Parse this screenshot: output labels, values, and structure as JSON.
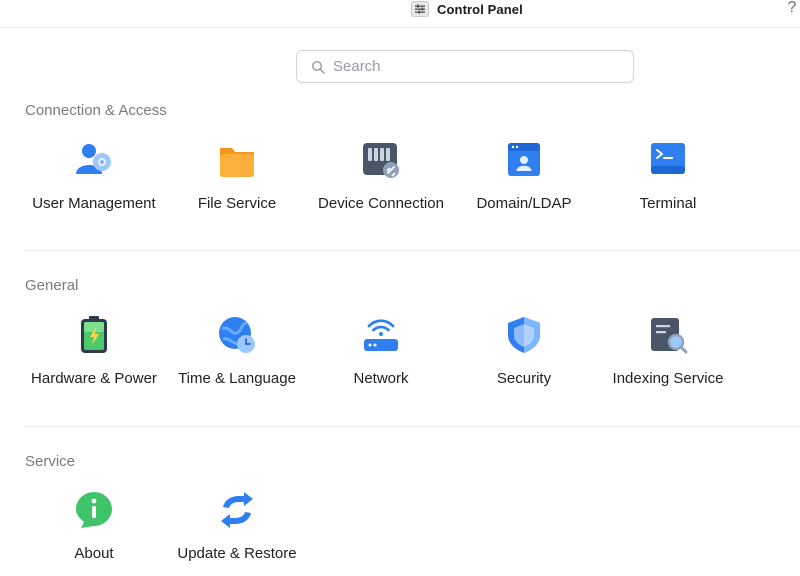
{
  "window": {
    "title": "Control Panel",
    "help_label": "?"
  },
  "search": {
    "placeholder": "Search"
  },
  "sections": [
    {
      "title": "Connection & Access",
      "items": [
        {
          "label": "User Management",
          "icon": "user-management-icon"
        },
        {
          "label": "File Service",
          "icon": "folder-icon"
        },
        {
          "label": "Device Connection",
          "icon": "device-connection-icon"
        },
        {
          "label": "Domain/LDAP",
          "icon": "domain-ldap-icon"
        },
        {
          "label": "Terminal",
          "icon": "terminal-icon"
        }
      ]
    },
    {
      "title": "General",
      "items": [
        {
          "label": "Hardware & Power",
          "icon": "battery-icon"
        },
        {
          "label": "Time & Language",
          "icon": "globe-clock-icon"
        },
        {
          "label": "Network",
          "icon": "router-icon"
        },
        {
          "label": "Security",
          "icon": "shield-icon"
        },
        {
          "label": "Indexing Service",
          "icon": "indexing-search-icon"
        }
      ]
    },
    {
      "title": "Service",
      "items": [
        {
          "label": "About",
          "icon": "info-icon"
        },
        {
          "label": "Update & Restore",
          "icon": "update-arrows-icon"
        }
      ]
    }
  ],
  "colors": {
    "accent_blue": "#2f7ff0",
    "orange": "#f9a02b",
    "green": "#3fc46a",
    "section_text": "#7a7a80"
  }
}
